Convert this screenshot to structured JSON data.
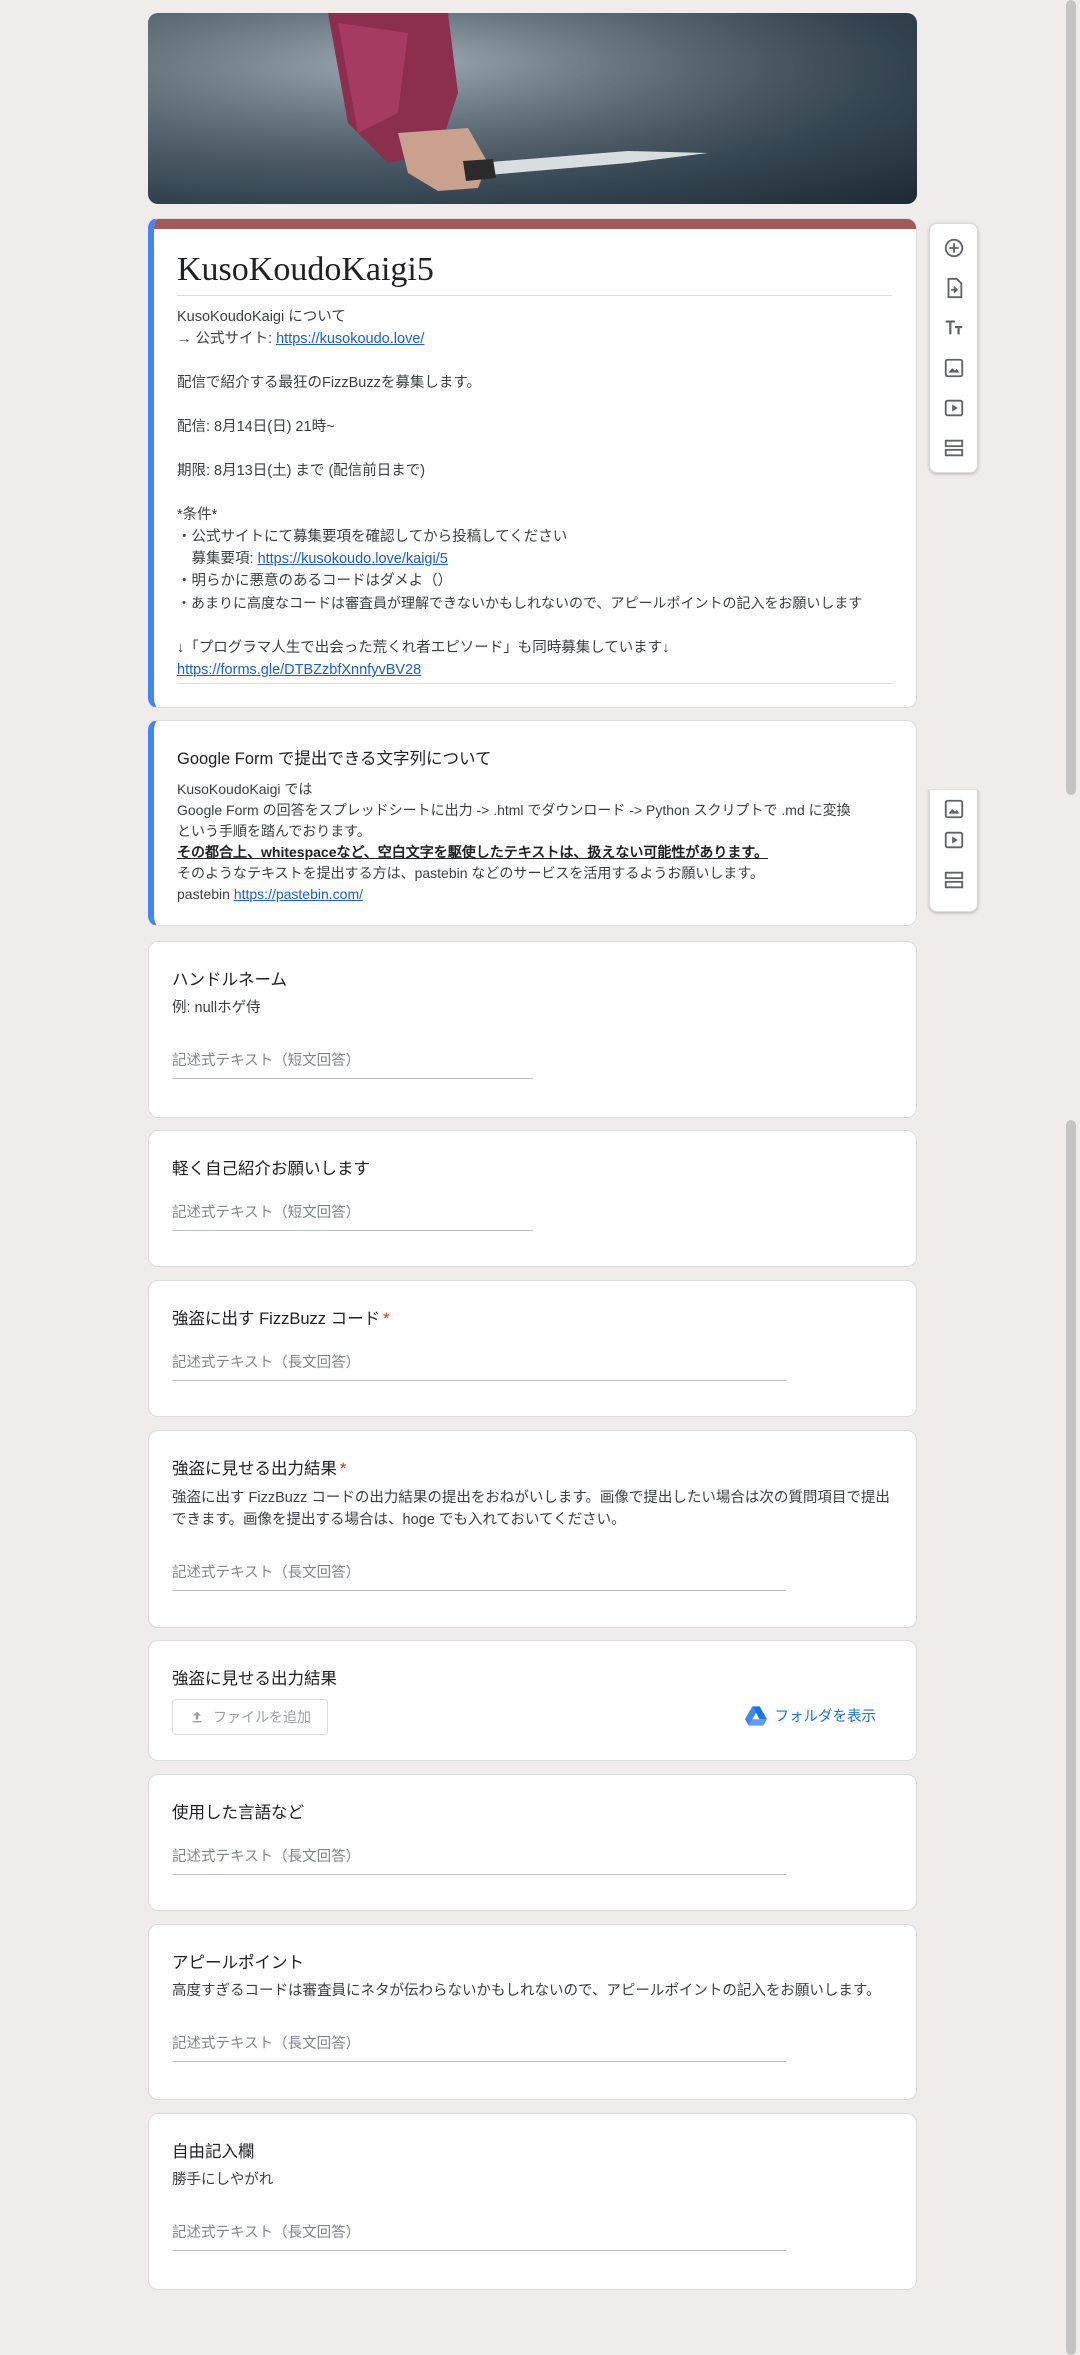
{
  "form": {
    "title": "KusoKoudoKaigi5",
    "desc": {
      "l1": "KusoKoudoKaigi について",
      "l2_prefix": "→ 公式サイト: ",
      "l2_link": "https://kusokoudo.love/",
      "l3": "配信で紹介する最狂のFizzBuzzを募集します。",
      "l4": "配信: 8月14日(日) 21時~",
      "l5": "期限: 8月13日(土) まで (配信前日まで)",
      "l6": "*条件*",
      "l7": "・公式サイトにて募集要項を確認してから投稿してください",
      "l8_prefix": "　募集要項: ",
      "l8_link": "https://kusokoudo.love/kaigi/5",
      "l9": "・明らかに悪意のあるコードはダメよ（）",
      "l10": "・あまりに高度なコードは審査員が理解できないかもしれないので、アピールポイントの記入をお願いします",
      "l11": "↓「プログラマ人生で出会った荒くれ者エピソード」も同時募集しています↓",
      "l12_link": "https://forms.gle/DTBZzbfXnnfyvBV28"
    }
  },
  "section": {
    "title": "Google Form で提出できる文字列について",
    "l1": "KusoKoudoKaigi では",
    "l2": "Google Form の回答をスプレッドシートに出力 -> .html でダウンロード -> Python スクリプトで .md に変換",
    "l3": "という手順を踏んでおります。",
    "l4": "その都合上、whitespaceなど、空白文字を駆使したテキストは、扱えない可能性があります。",
    "l5": "そのようなテキストを提出する方は、pastebin などのサービスを活用するようお願いします。",
    "l6_prefix": "pastebin  ",
    "l6_link": "https://pastebin.com/"
  },
  "questions": {
    "handle": {
      "title": "ハンドルネーム",
      "sub": "例: nullホゲ侍",
      "placeholder": "記述式テキスト（短文回答）"
    },
    "intro": {
      "title": "軽く自己紹介お願いします",
      "placeholder": "記述式テキスト（短文回答）"
    },
    "code": {
      "title": "強盗に出す FizzBuzz コード",
      "required": "*",
      "placeholder": "記述式テキスト（長文回答）"
    },
    "output": {
      "title": "強盗に見せる出力結果",
      "required": "*",
      "sub": "強盗に出す FizzBuzz コードの出力結果の提出をおねがいします。画像で提出したい場合は次の質問項目で提出できます。画像を提出する場合は、hoge でも入れておいてください。",
      "placeholder": "記述式テキスト（長文回答）"
    },
    "output_file": {
      "title": "強盗に見せる出力結果",
      "upload_label": "ファイルを追加",
      "folder_label": "フォルダを表示"
    },
    "lang": {
      "title": "使用した言語など",
      "placeholder": "記述式テキスト（長文回答）"
    },
    "appeal": {
      "title": "アピールポイント",
      "sub": "高度すぎるコードは審査員にネタが伝わらないかもしれないので、アピールポイントの記入をお願いします。",
      "placeholder": "記述式テキスト（長文回答）"
    },
    "free": {
      "title": "自由記入欄",
      "sub": "勝手にしやがれ",
      "placeholder": "記述式テキスト（長文回答）"
    }
  },
  "toolbar": {
    "buttons": [
      "add-question",
      "import-questions",
      "add-title-and-description",
      "add-image",
      "add-video",
      "add-section"
    ]
  },
  "colors": {
    "accent": "#4285f4",
    "theme": "#a05a5a",
    "background": "#f1ecec",
    "required": "#d93025",
    "link": "#1a5fd3"
  }
}
